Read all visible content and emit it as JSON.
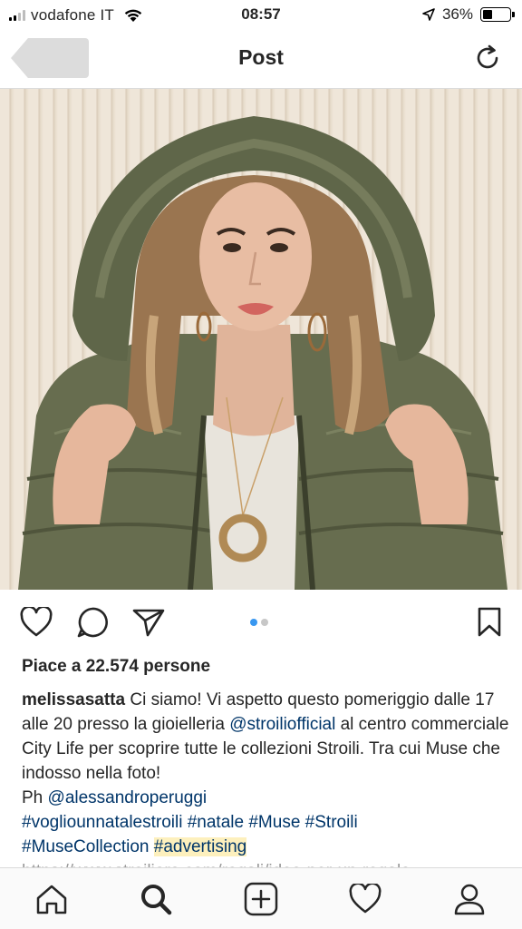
{
  "status_bar": {
    "carrier": "vodafone IT",
    "time": "08:57",
    "battery_percent": "36%",
    "battery_level": 0.36,
    "signal_bars": 2
  },
  "nav": {
    "title": "Post",
    "icons": [
      "back-icon",
      "refresh-icon"
    ]
  },
  "post": {
    "carousel_dots": 2,
    "carousel_active": 1,
    "likes_text": "Piace a 22.574 persone",
    "caption": {
      "username": "melissasatta",
      "text1": " Ci siamo! Vi aspetto questo pomeriggio dalle 17 alle 20 presso la gioielleria ",
      "mention1": "@stroiliofficial",
      "text2": " al centro commerciale City Life per scoprire tutte le collezioni Stroili. Tra cui Muse che indosso nella foto!",
      "ph_prefix": "Ph ",
      "mention2": "@alessandroperuggi",
      "hashtags": [
        "#vogliounnatalestroili",
        "#natale",
        "#Muse",
        "#Stroili",
        "#MuseCollection"
      ],
      "highlighted_hashtag": "#advertising",
      "url": "https://www.stroilioro.com/regali/idee-per-un-regalo-"
    },
    "action_icons": [
      "heart-icon",
      "comment-icon",
      "share-icon",
      "bookmark-icon"
    ]
  },
  "tabbar": {
    "icons": [
      "home-icon",
      "search-icon",
      "add-icon",
      "activity-icon",
      "profile-icon"
    ]
  },
  "colors": {
    "link": "#003569",
    "carousel_active": "#3897f0",
    "highlight": "#fdf0bd"
  }
}
